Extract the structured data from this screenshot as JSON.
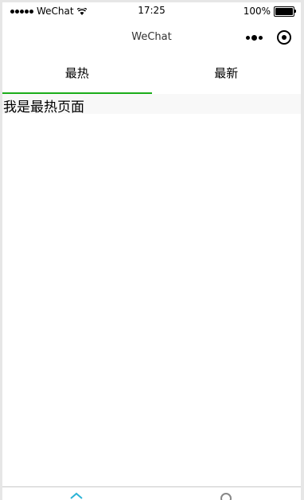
{
  "status_bar": {
    "carrier": "WeChat",
    "time": "17:25",
    "battery": "100%"
  },
  "nav": {
    "title": "WeChat"
  },
  "tabs": [
    {
      "label": "最热",
      "active": true
    },
    {
      "label": "最新",
      "active": false
    }
  ],
  "content": {
    "text": "我是最热页面"
  },
  "colors": {
    "accent": "#1aad19",
    "tabbar_icon_active": "#2bb3d6",
    "tabbar_icon_inactive": "#888888"
  },
  "tabbar": {
    "icons": [
      "home-icon",
      "user-icon"
    ]
  }
}
